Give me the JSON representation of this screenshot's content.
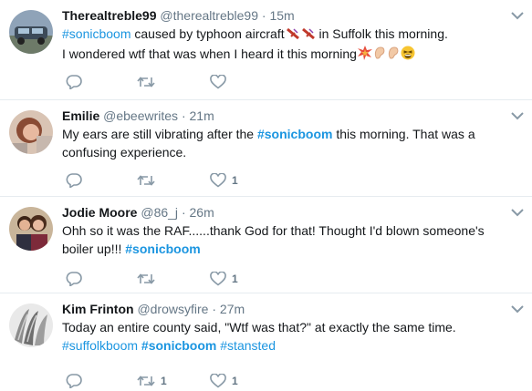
{
  "tweets": [
    {
      "name": "Therealtreble99",
      "handle": "@therealtreble99",
      "separator": "·",
      "time": "15m",
      "text": {
        "hashtag": "#sonicboom",
        "part1": " caused by typhoon aircraft",
        "part2": " in Suffolk this morning.",
        "line2": "I wondered wtf that was when I heard it this morning"
      },
      "emoji": [
        "airplane-icon",
        "airplane-icon",
        "collision-icon",
        "ear-icon",
        "ear-icon",
        "tired-face-icon"
      ],
      "replies": "",
      "retweets": "",
      "likes": ""
    },
    {
      "name": "Emilie",
      "handle": "@ebeewrites",
      "separator": "·",
      "time": "21m",
      "text": {
        "part1": "My ears are still vibrating after the ",
        "hashtag": "#sonicboom",
        "part2": " this morning. That was a confusing experience."
      },
      "replies": "",
      "retweets": "",
      "likes": "1"
    },
    {
      "name": "Jodie Moore",
      "handle": "@86_j",
      "separator": "·",
      "time": "26m",
      "text": {
        "part1": "Ohh so it was the RAF......thank God for that! Thought I'd blown someone's boiler up!!! ",
        "hashtag": "#sonicboom"
      },
      "replies": "",
      "retweets": "",
      "likes": "1"
    },
    {
      "name": "Kim Frinton",
      "handle": "@drowsyfire",
      "separator": "·",
      "time": "27m",
      "text": {
        "part1": "Today an entire county said, \"Wtf was that?\" at exactly the same time.",
        "hashtag1": "#suffolkboom",
        "hashtag2": "#sonicboom",
        "hashtag3": "#stansted"
      },
      "replies": "",
      "retweets": "1",
      "likes": "1"
    }
  ],
  "colors": {
    "link": "#1b95e0",
    "muted": "#657786",
    "divider": "#e6ecf0",
    "text": "#14171a"
  }
}
